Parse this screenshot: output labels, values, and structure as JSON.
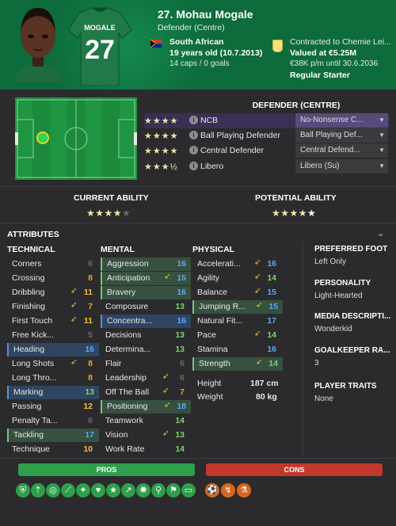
{
  "player": {
    "name": "27. Mohau Mogale",
    "position": "Defender (Centre)",
    "shirt_name": "MOGALE",
    "shirt_number": "27",
    "nationality": "South African",
    "age": "19 years old (10.7.2013)",
    "caps": "14 caps / 0 goals",
    "contract": "Contracted to Chemie Lei...",
    "value": "Valued at €5.25M",
    "wage": "€38K p/m until 30.6.2036",
    "squad_status": "Regular Starter"
  },
  "positions": {
    "header": "DEFENDER (CENTRE)",
    "roles": [
      {
        "stars": "★★★★",
        "name": "NCB",
        "duty": "No-Nonsense C...",
        "selected": true
      },
      {
        "stars": "★★★★",
        "name": "Ball Playing Defender",
        "duty": "Ball Playing Def...",
        "selected": false
      },
      {
        "stars": "★★★★",
        "name": "Central Defender",
        "duty": "Central Defend...",
        "selected": false
      },
      {
        "stars": "★★★½",
        "name": "Libero",
        "duty": "Libero (Su)",
        "selected": false
      }
    ]
  },
  "ability": {
    "current_label": "CURRENT ABILITY",
    "current_stars": "★★★★",
    "current_rating": 4,
    "potential_label": "POTENTIAL ABILITY",
    "potential_stars": "★★★★",
    "potential_rating": 5
  },
  "attributes": {
    "header": "ATTRIBUTES",
    "technical_label": "TECHNICAL",
    "mental_label": "MENTAL",
    "physical_label": "PHYSICAL",
    "technical": [
      {
        "name": "Corners",
        "value": "6",
        "arrow": false,
        "hl": ""
      },
      {
        "name": "Crossing",
        "value": "8",
        "arrow": false,
        "hl": ""
      },
      {
        "name": "Dribbling",
        "value": "11",
        "arrow": true,
        "hl": ""
      },
      {
        "name": "Finishing",
        "value": "7",
        "arrow": true,
        "hl": ""
      },
      {
        "name": "First Touch",
        "value": "11",
        "arrow": true,
        "hl": ""
      },
      {
        "name": "Free Kick...",
        "value": "5",
        "arrow": false,
        "hl": ""
      },
      {
        "name": "Heading",
        "value": "16",
        "arrow": false,
        "hl": "hb"
      },
      {
        "name": "Long Shots",
        "value": "8",
        "arrow": true,
        "hl": ""
      },
      {
        "name": "Long Thro...",
        "value": "8",
        "arrow": false,
        "hl": ""
      },
      {
        "name": "Marking",
        "value": "13",
        "arrow": false,
        "hl": "hb"
      },
      {
        "name": "Passing",
        "value": "12",
        "arrow": false,
        "hl": ""
      },
      {
        "name": "Penalty Ta...",
        "value": "6",
        "arrow": false,
        "hl": ""
      },
      {
        "name": "Tackling",
        "value": "17",
        "arrow": false,
        "hl": "hg"
      },
      {
        "name": "Technique",
        "value": "10",
        "arrow": false,
        "hl": ""
      }
    ],
    "mental": [
      {
        "name": "Aggression",
        "value": "16",
        "arrow": false,
        "hl": "hg"
      },
      {
        "name": "Anticipation",
        "value": "15",
        "arrow": true,
        "hl": "hg"
      },
      {
        "name": "Bravery",
        "value": "16",
        "arrow": false,
        "hl": "hg"
      },
      {
        "name": "Composure",
        "value": "13",
        "arrow": false,
        "hl": ""
      },
      {
        "name": "Concentra...",
        "value": "16",
        "arrow": false,
        "hl": "hb"
      },
      {
        "name": "Decisions",
        "value": "13",
        "arrow": false,
        "hl": ""
      },
      {
        "name": "Determina...",
        "value": "13",
        "arrow": false,
        "hl": ""
      },
      {
        "name": "Flair",
        "value": "6",
        "arrow": false,
        "hl": ""
      },
      {
        "name": "Leadership",
        "value": "6",
        "arrow": true,
        "hl": ""
      },
      {
        "name": "Off The Ball",
        "value": "7",
        "arrow": true,
        "hl": ""
      },
      {
        "name": "Positioning",
        "value": "18",
        "arrow": true,
        "hl": "hg"
      },
      {
        "name": "Teamwork",
        "value": "14",
        "arrow": false,
        "hl": ""
      },
      {
        "name": "Vision",
        "value": "13",
        "arrow": true,
        "hl": ""
      },
      {
        "name": "Work Rate",
        "value": "14",
        "arrow": false,
        "hl": ""
      }
    ],
    "physical": [
      {
        "name": "Accelerati...",
        "value": "16",
        "arrow": true,
        "hl": ""
      },
      {
        "name": "Agility",
        "value": "14",
        "arrow": true,
        "hl": ""
      },
      {
        "name": "Balance",
        "value": "15",
        "arrow": true,
        "hl": ""
      },
      {
        "name": "Jumping R...",
        "value": "15",
        "arrow": true,
        "hl": "hg"
      },
      {
        "name": "Natural Fit...",
        "value": "17",
        "arrow": false,
        "hl": ""
      },
      {
        "name": "Pace",
        "value": "14",
        "arrow": true,
        "hl": ""
      },
      {
        "name": "Stamina",
        "value": "16",
        "arrow": false,
        "hl": ""
      },
      {
        "name": "Strength",
        "value": "14",
        "arrow": true,
        "hl": "hg"
      }
    ],
    "height_label": "Height",
    "height": "187 cm",
    "weight_label": "Weight",
    "weight": "80 kg"
  },
  "side": {
    "foot_label": "PREFERRED FOOT",
    "foot": "Left Only",
    "personality_label": "PERSONALITY",
    "personality": "Light-Hearted",
    "media_label": "MEDIA DESCRIPTI...",
    "media": "Wonderkid",
    "gk_label": "GOALKEEPER RA...",
    "gk": "3",
    "traits_label": "PLAYER TRAITS",
    "traits": "None"
  },
  "pros_label": "PROS",
  "cons_label": "CONS",
  "pro_icons": [
    "defending-icon",
    "aerial-icon",
    "focus-icon",
    "tackle-icon",
    "anticipation-icon",
    "bravery-icon",
    "star-icon",
    "growth-icon",
    "mental-icon",
    "positioning-icon",
    "flag-icon",
    "physical-icon"
  ],
  "con_icons": [
    "finishing-icon",
    "crossing-icon",
    "setpiece-icon"
  ],
  "colors": {
    "header_green": "#0e6b3c",
    "pros": "#2e9f4b",
    "cons": "#c0392b",
    "highlight_green": "#79c47b",
    "highlight_blue": "#5e8fd0"
  }
}
